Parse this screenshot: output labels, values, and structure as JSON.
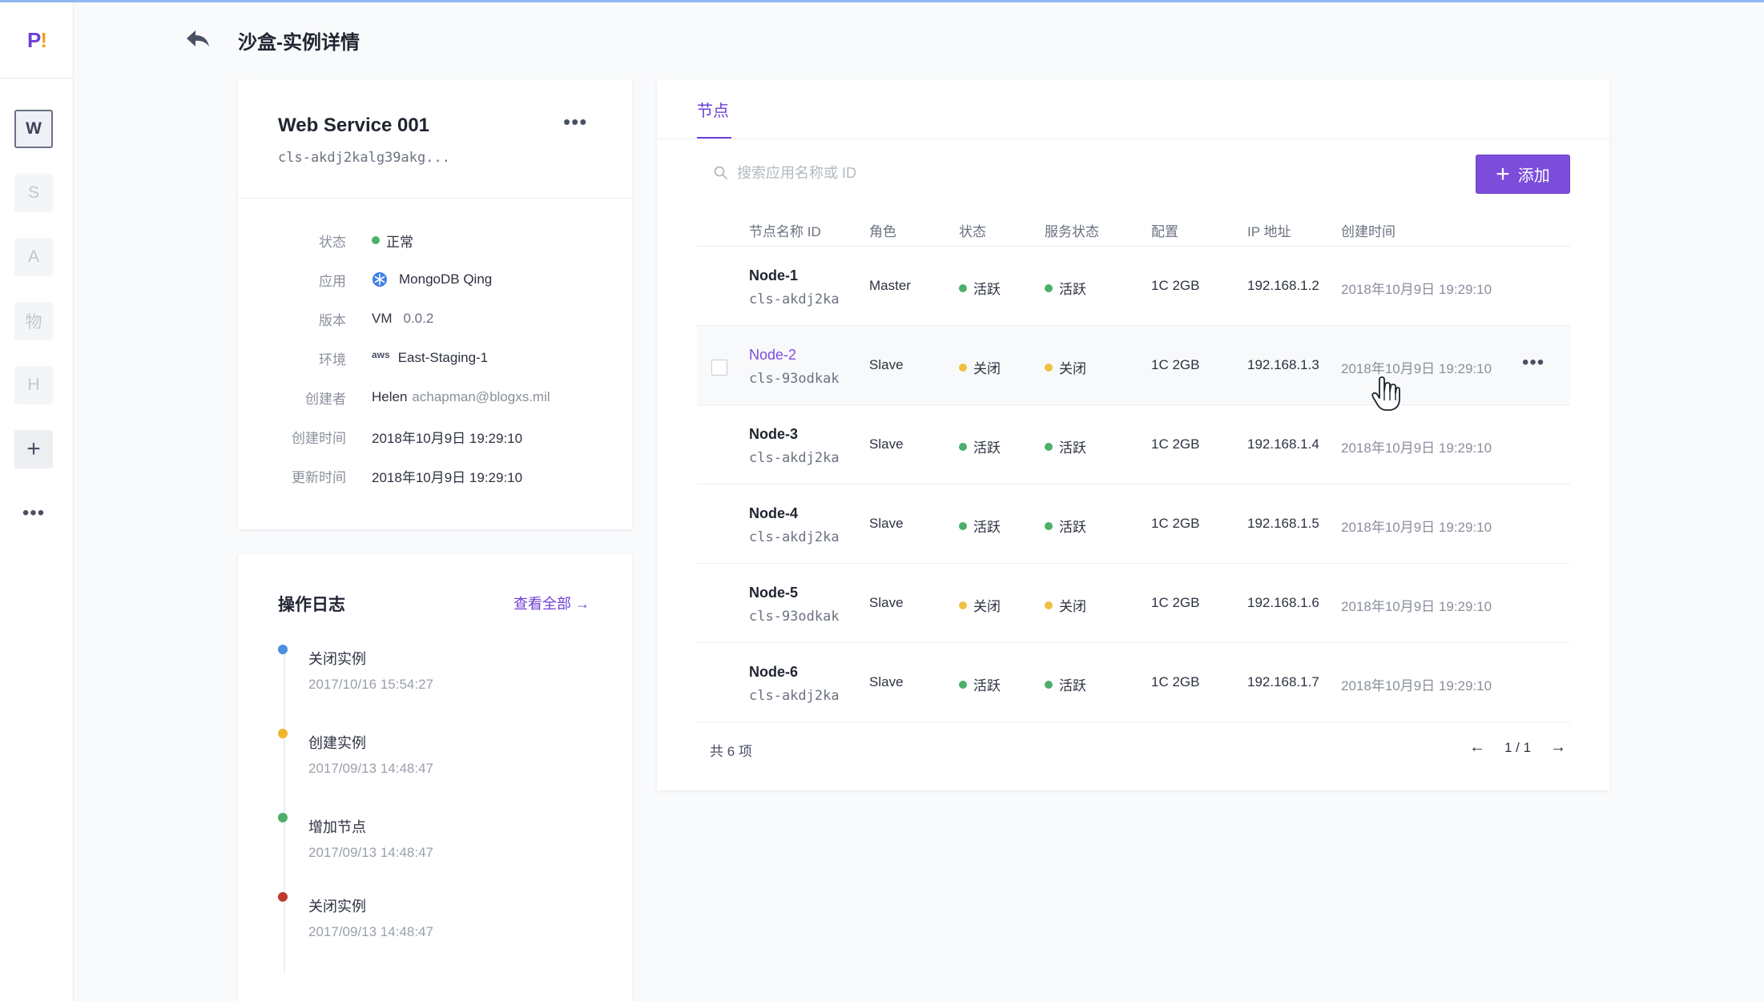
{
  "app": {
    "logo_p": "P",
    "logo_bang": "!"
  },
  "sidebar": {
    "workspaces": [
      {
        "label": "W",
        "active": true
      },
      {
        "label": "S"
      },
      {
        "label": "A"
      },
      {
        "label": "物"
      },
      {
        "label": "H"
      }
    ],
    "add_icon": "plus-icon",
    "more_icon": "more-icon"
  },
  "header": {
    "title": "沙盒-实例详情",
    "back_icon": "back-arrow-icon"
  },
  "instance": {
    "name": "Web Service 001",
    "id": "cls-akdj2kalg39akg...",
    "fields": {
      "status_label": "状态",
      "status_value": "正常",
      "app_label": "应用",
      "app_value": "MongoDB Qing",
      "version_label": "版本",
      "version_prefix": "VM",
      "version_value": "0.0.2",
      "env_label": "环境",
      "env_provider": "aws",
      "env_value": "East-Staging-1",
      "creator_label": "创建者",
      "creator_name": "Helen",
      "creator_email": "achapman@blogxs.mil",
      "created_label": "创建时间",
      "created_value": "2018年10月9日 19:29:10",
      "updated_label": "更新时间",
      "updated_value": "2018年10月9日 19:29:10"
    }
  },
  "logs": {
    "title": "操作日志",
    "view_all": "查看全部 →",
    "items": [
      {
        "action": "关闭实例",
        "time": "2017/10/16 15:54:27",
        "color": "#4a90e2"
      },
      {
        "action": "创建实例",
        "time": "2017/09/13 14:48:47",
        "color": "#f0b429"
      },
      {
        "action": "增加节点",
        "time": "2017/09/13 14:48:47",
        "color": "#4caf6a"
      },
      {
        "action": "关闭实例",
        "time": "2017/09/13 14:48:47",
        "color": "#c0392b"
      }
    ]
  },
  "nodes": {
    "tab": "节点",
    "search_placeholder": "搜索应用名称或 ID",
    "add_button": "添加",
    "columns": [
      "节点名称 ID",
      "角色",
      "状态",
      "服务状态",
      "配置",
      "IP 地址",
      "创建时间"
    ],
    "rows": [
      {
        "name": "Node-1",
        "id": "cls-akdj2ka",
        "role": "Master",
        "status": "活跃",
        "service": "活跃",
        "config": "1C 2GB",
        "ip": "192.168.1.2",
        "created": "2018年10月9日 19:29:10",
        "state": "active"
      },
      {
        "name": "Node-2",
        "id": "cls-93odkak",
        "role": "Slave",
        "status": "关闭",
        "service": "关闭",
        "config": "1C 2GB",
        "ip": "192.168.1.3",
        "created": "2018年10月9日 19:29:10",
        "state": "closed"
      },
      {
        "name": "Node-3",
        "id": "cls-akdj2ka",
        "role": "Slave",
        "status": "活跃",
        "service": "活跃",
        "config": "1C 2GB",
        "ip": "192.168.1.4",
        "created": "2018年10月9日 19:29:10",
        "state": "active"
      },
      {
        "name": "Node-4",
        "id": "cls-akdj2ka",
        "role": "Slave",
        "status": "活跃",
        "service": "活跃",
        "config": "1C 2GB",
        "ip": "192.168.1.5",
        "created": "2018年10月9日 19:29:10",
        "state": "active"
      },
      {
        "name": "Node-5",
        "id": "cls-93odkak",
        "role": "Slave",
        "status": "关闭",
        "service": "关闭",
        "config": "1C 2GB",
        "ip": "192.168.1.6",
        "created": "2018年10月9日 19:29:10",
        "state": "closed"
      },
      {
        "name": "Node-6",
        "id": "cls-akdj2ka",
        "role": "Slave",
        "status": "活跃",
        "service": "活跃",
        "config": "1C 2GB",
        "ip": "192.168.1.7",
        "created": "2018年10月9日 19:29:10",
        "state": "active"
      }
    ],
    "total": "共 6 项",
    "page_info": "1 / 1",
    "prev": "←",
    "next": "→"
  },
  "colors": {
    "accent": "#7c4ddb",
    "active": "#4caf6a",
    "closed": "#f0c040"
  }
}
